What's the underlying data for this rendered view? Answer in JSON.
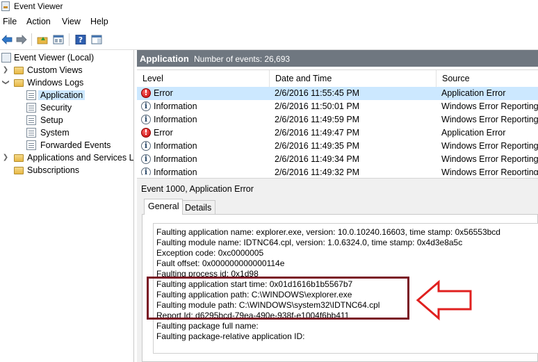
{
  "window": {
    "title": "Event Viewer"
  },
  "menu": [
    "File",
    "Action",
    "View",
    "Help"
  ],
  "toolbar": [
    "back-icon",
    "forward-icon",
    "folder-up-icon",
    "properties-icon",
    "help-icon",
    "show-pane-icon"
  ],
  "tree": {
    "root": "Event Viewer (Local)",
    "custom_views": "Custom Views",
    "windows_logs": "Windows Logs",
    "application": "Application",
    "security": "Security",
    "setup": "Setup",
    "system": "System",
    "forwarded": "Forwarded Events",
    "apps_services": "Applications and Services Lo",
    "subscriptions": "Subscriptions"
  },
  "header": {
    "title": "Application",
    "count": "Number of events: 26,693"
  },
  "grid": {
    "columns": [
      "Level",
      "Date and Time",
      "Source"
    ],
    "rows": [
      {
        "level": "Error",
        "datetime": "2/6/2016 11:55:45 PM",
        "source": "Application Error"
      },
      {
        "level": "Information",
        "datetime": "2/6/2016 11:50:01 PM",
        "source": "Windows Error Reporting"
      },
      {
        "level": "Information",
        "datetime": "2/6/2016 11:49:59 PM",
        "source": "Windows Error Reporting"
      },
      {
        "level": "Error",
        "datetime": "2/6/2016 11:49:47 PM",
        "source": "Application Error"
      },
      {
        "level": "Information",
        "datetime": "2/6/2016 11:49:35 PM",
        "source": "Windows Error Reporting"
      },
      {
        "level": "Information",
        "datetime": "2/6/2016 11:49:34 PM",
        "source": "Windows Error Reporting"
      },
      {
        "level": "Information",
        "datetime": "2/6/2016 11:49:32 PM",
        "source": "Windows Error Reporting"
      }
    ]
  },
  "detail": {
    "title": "Event 1000, Application Error",
    "tabs": [
      "General",
      "Details"
    ],
    "lines": [
      "Faulting application name: explorer.exe, version: 10.0.10240.16603, time stamp: 0x56553bcd",
      "Faulting module name: IDTNC64.cpl, version: 1.0.6324.0, time stamp: 0x4d3e8a5c",
      "Exception code: 0xc0000005",
      "Fault offset: 0x000000000000114e",
      "Faulting process id: 0x1d98",
      "Faulting application start time: 0x01d1616b1b5567b7",
      "Faulting application path: C:\\WINDOWS\\explorer.exe",
      "Faulting module path: C:\\WINDOWS\\system32\\IDTNC64.cpl",
      "Report Id: d6295bcd-79ea-490e-938f-e1004f6bb411",
      "Faulting package full name:",
      "Faulting package-relative application ID:"
    ]
  },
  "colors": {
    "highlight_box": "#7a1424",
    "arrow": "#e0201f",
    "selection": "#cce8ff",
    "header_bg": "#6f7780"
  }
}
